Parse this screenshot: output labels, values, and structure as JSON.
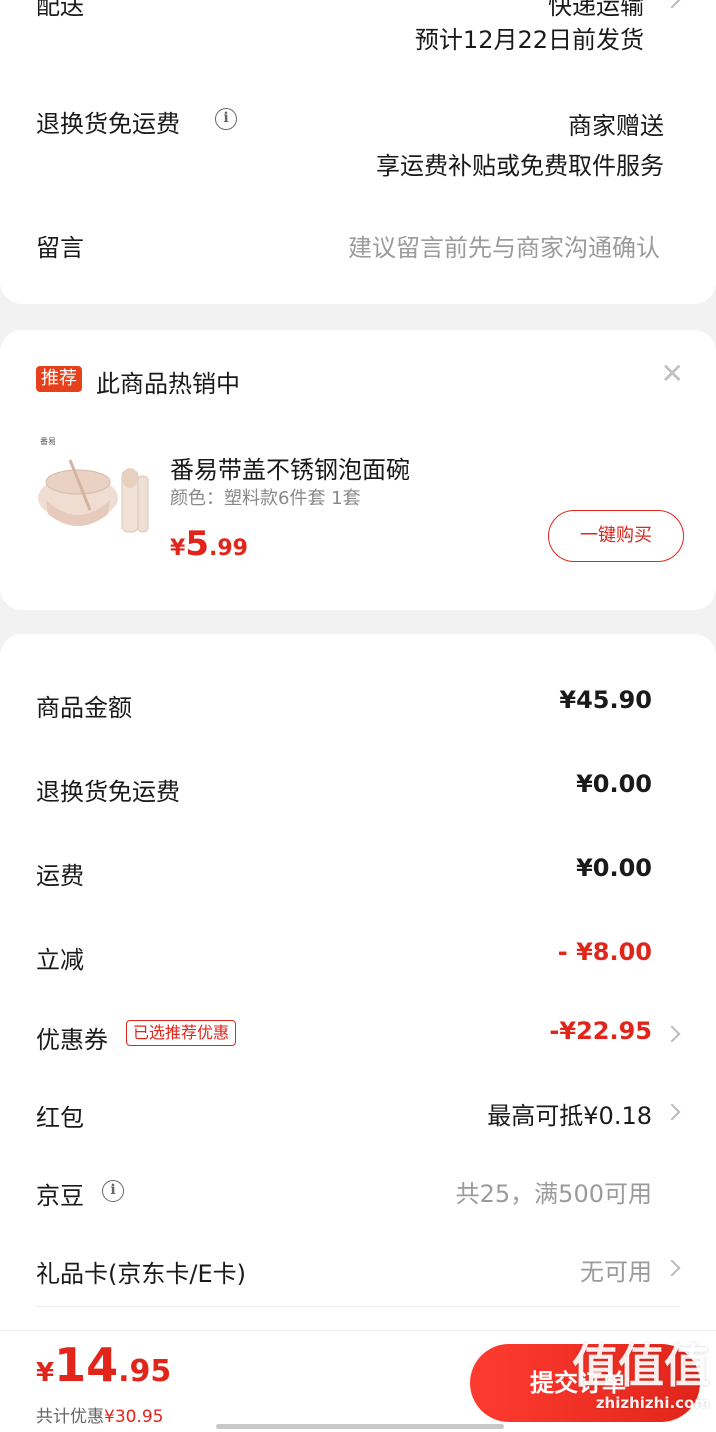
{
  "delivery": {
    "label": "配送",
    "method": "快递运输",
    "estimate": "预计12月22日前发货"
  },
  "return_shipping": {
    "label": "退换货免运费",
    "value": "商家赠送",
    "desc": "享运费补贴或免费取件服务"
  },
  "message": {
    "label": "留言",
    "placeholder": "建议留言前先与商家沟通确认"
  },
  "recommend": {
    "badge": "推荐",
    "title": "此商品热销中",
    "product_name": "番易带盖不锈钢泡面碗",
    "spec": "颜色：塑料款6件套  1套",
    "price_symbol": "¥",
    "price_int": "5",
    "price_dec": ".99",
    "buy_label": "一键购买",
    "thumb_brand": "番易"
  },
  "summary": {
    "items": [
      {
        "label": "商品金额",
        "value": "¥45.90"
      },
      {
        "label": "退换货免运费",
        "value": "¥0.00"
      },
      {
        "label": "运费",
        "value": "¥0.00"
      },
      {
        "label": "立减",
        "value": "- ¥8.00"
      },
      {
        "label": "优惠券",
        "tag": "已选推荐优惠",
        "value": "-¥22.95"
      },
      {
        "label": "红包",
        "value": "最高可抵¥0.18"
      },
      {
        "label": "京豆",
        "value": "共25，满500可用"
      },
      {
        "label": "礼品卡(京东卡/E卡)",
        "value": "无可用"
      }
    ]
  },
  "bottom": {
    "total_symbol": "¥",
    "total_int": "14",
    "total_dec": ".95",
    "saved_label": "共计优惠",
    "saved_value": "¥30.95",
    "submit_label": "提交订单"
  },
  "watermark": {
    "main": "值值值",
    "sub": "zhizhizhi.com"
  },
  "colors": {
    "accent": "#e1251b",
    "gray_text": "#9b9b9b",
    "background": "#f2f2f2"
  }
}
